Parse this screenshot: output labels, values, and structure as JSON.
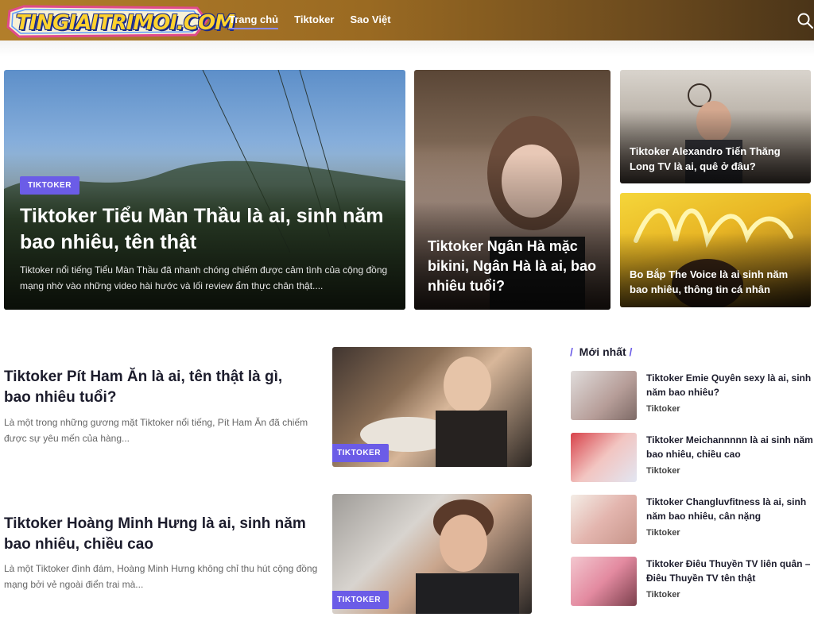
{
  "site": {
    "logo_text": "TINGIAITRIMOI.COM",
    "brand_colors": {
      "header_gradient_start": "#b27e2a",
      "header_gradient_end": "#4a3418",
      "accent": "#6b5ce7",
      "logo_yellow": "#ffd22e",
      "logo_blue": "#1a2a8a"
    }
  },
  "nav": {
    "items": [
      "Trang chủ",
      "Tiktoker",
      "Sao Việt"
    ],
    "active": "Trang chủ",
    "search_icon": "search-icon"
  },
  "featured": {
    "main": {
      "badge": "TIKTOKER",
      "title": "Tiktoker Tiểu Màn Thầu là ai, sinh năm bao nhiêu, tên thật",
      "excerpt": "Tiktoker nổi tiếng Tiểu Màn Thầu đã nhanh chóng chiếm được cảm tình của cộng đồng mạng nhờ vào những video hài hước và lối review ẩm thực chân thật...."
    },
    "second": {
      "title": "Tiktoker Ngân Hà mặc bikini, Ngân Hà là ai, bao nhiêu tuổi?"
    },
    "third": {
      "title": "Tiktoker Alexandro Tiến Thăng Long TV là ai, quê ở đâu?"
    },
    "fourth": {
      "title": "Bo Bắp The Voice là ai sinh năm bao nhiêu, thông tin cá nhân"
    }
  },
  "articles": [
    {
      "title": "Tiktoker Pít Ham Ăn là ai, tên thật là gì, bao nhiêu tuổi?",
      "excerpt": "Là một trong những gương mặt Tiktoker nổi tiếng, Pít Ham Ăn đã chiếm được sự yêu mến của hàng...",
      "badge": "TIKTOKER"
    },
    {
      "title": "Tiktoker Hoàng Minh Hưng là ai, sinh năm bao nhiêu, chiều cao",
      "excerpt": "Là một Tiktoker đình đám, Hoàng Minh Hưng không chỉ thu hút cộng đồng mạng bởi vẻ ngoài điển trai mà...",
      "badge": "TIKTOKER"
    }
  ],
  "sidebar": {
    "heading": "Mới nhất",
    "items": [
      {
        "title": "Tiktoker Emie Quyên sexy là ai, sinh năm bao nhiêu?",
        "category": "Tiktoker"
      },
      {
        "title": "Tiktoker Meichannnnn là ai sinh năm bao nhiêu, chiều cao",
        "category": "Tiktoker"
      },
      {
        "title": "Tiktoker Changluvfitness là ai, sinh năm bao nhiêu, cân nặng",
        "category": "Tiktoker"
      },
      {
        "title": "Tiktoker Điêu Thuyền TV liên quân – Điêu Thuyền TV tên thật",
        "category": "Tiktoker"
      }
    ]
  }
}
